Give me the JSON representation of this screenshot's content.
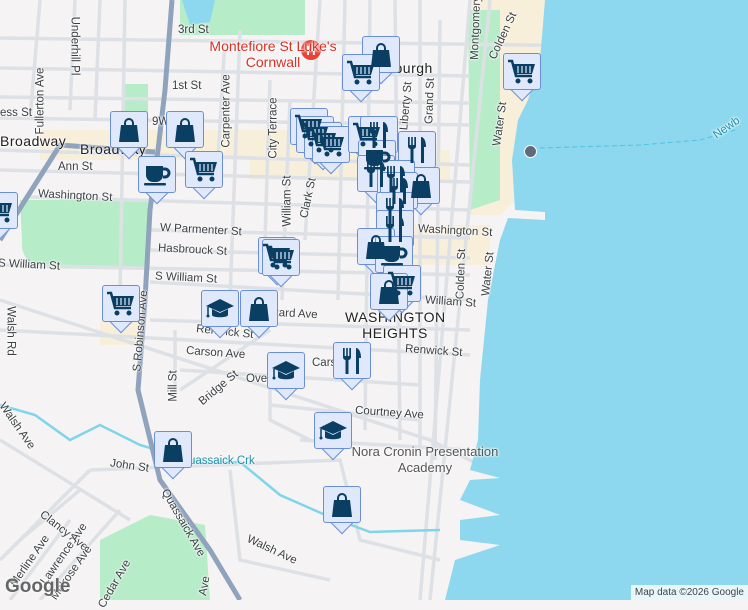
{
  "colors": {
    "water": "#8dd8ee",
    "park": "#b7ecc8",
    "commercial": "#f7efd9",
    "major_road": "#8fa3bd",
    "marker_fill": "#dfe9fb",
    "marker_icon": "#0b3e63"
  },
  "poi": {
    "hospital": "Montefiore St Luke's Cornwall",
    "hospital_icon": "H",
    "city": "Newburgh",
    "neighborhood": "WASHINGTON HEIGHTS",
    "school": "Nora Cronin Presentation Academy",
    "creek": "Quassaick Crk",
    "river": "Newb"
  },
  "streets": [
    "3rd St",
    "1st St",
    "ess St",
    "Broadway",
    "Broadway",
    "Ann St",
    "Washington St",
    "W Parmenter St",
    "Hasbrouck St",
    "S William St",
    "S William St",
    "Renwick St",
    "Carson Ave",
    "Courtney Ave",
    "Renwick St",
    "Washington St",
    "William St",
    "kard Ave",
    "John St",
    "Walsh Ave",
    "Underhill Pl",
    "Fullerton Ave",
    "Carpenter Ave",
    "City Terrace",
    "William St",
    "Clark St",
    "S Robinson Ave",
    "Mill St",
    "Quassaick Ave",
    "Liberty St",
    "Grand St",
    "Water St",
    "Colden St",
    "Montgomery",
    "Colden St",
    "Water St",
    "Clancy Ave",
    "Lawrence Ave",
    "Merline Ave",
    "Melrose Ave",
    "Walsh Rd",
    "Walsh Ave",
    "Bridge St",
    "Carson",
    "Over",
    "Cedar Ave",
    "9W",
    "Ave"
  ],
  "markers": [
    "bag",
    "cart",
    "cart",
    "bag",
    "bag",
    "coffee",
    "cart",
    "cart",
    "cart",
    "cart",
    "cart",
    "cart",
    "cart",
    "fork",
    "fork",
    "coffee",
    "bag",
    "fork",
    "fork",
    "fork",
    "fork",
    "fork",
    "bag",
    "coffee",
    "cart",
    "cart",
    "cart",
    "bag",
    "cart",
    "grad",
    "bag",
    "fork",
    "grad",
    "grad",
    "bag",
    "bag"
  ],
  "footer": {
    "logo": "Google",
    "attribution": "Map data ©2026 Google"
  }
}
